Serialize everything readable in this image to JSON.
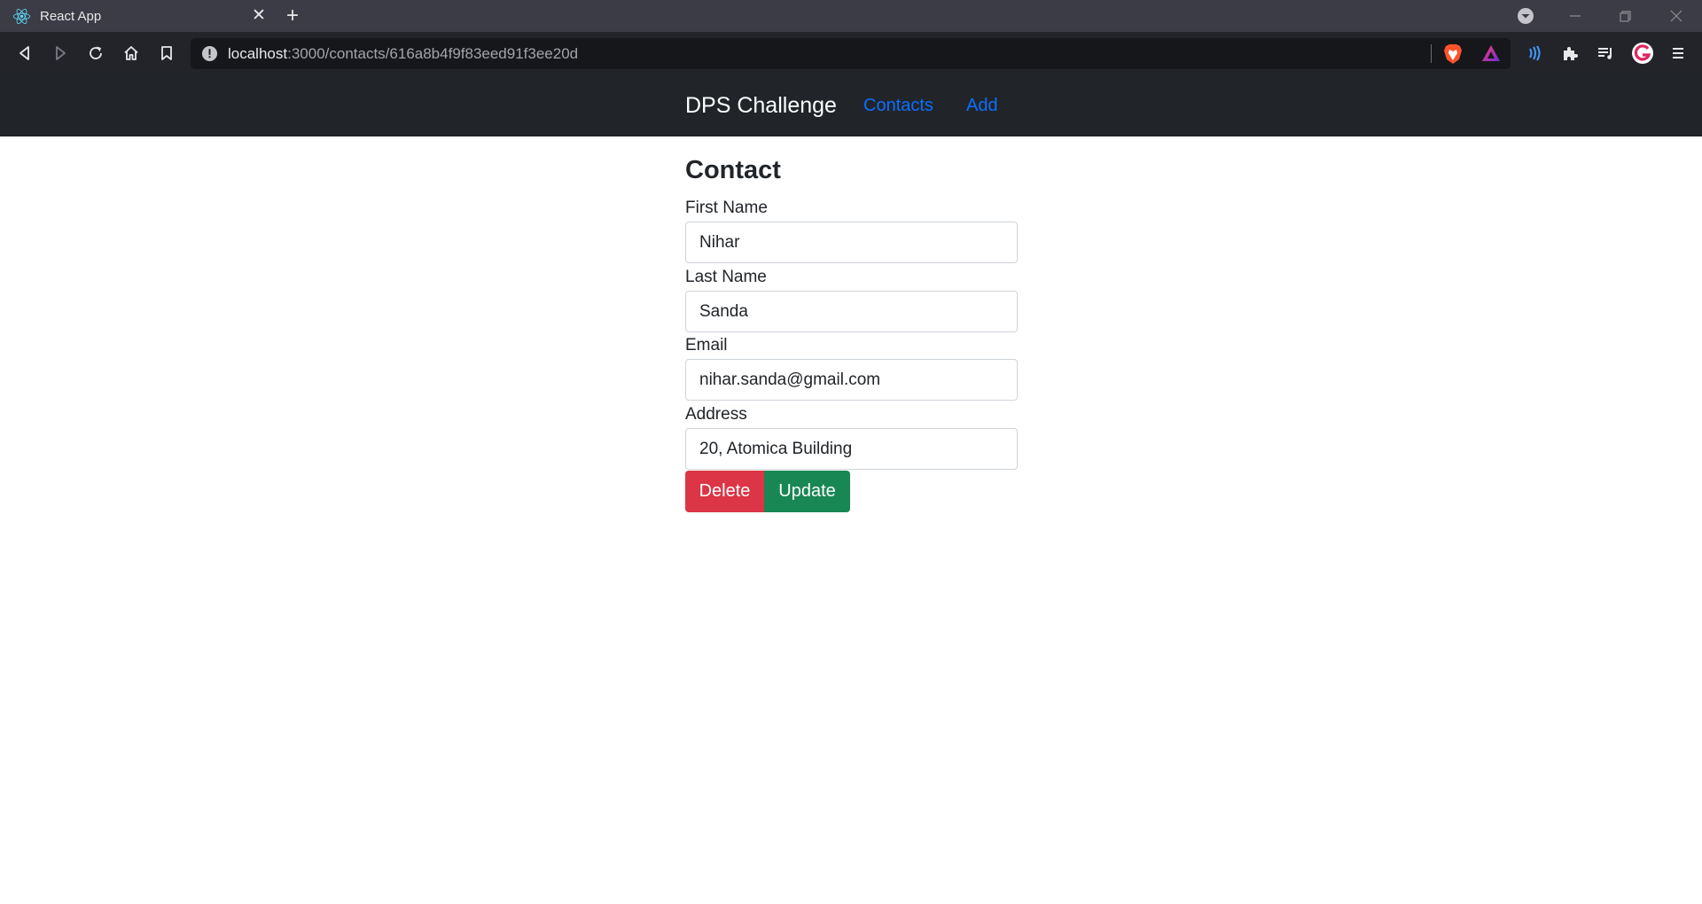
{
  "browser": {
    "tab_title": "React App",
    "new_tab_symbol": "+",
    "close_tab_symbol": "✕",
    "url_host": "localhost",
    "url_rest": ":3000/contacts/616a8b4f9f83eed91f3ee20d",
    "icons": [
      "react-favicon-icon",
      "back-icon",
      "forward-icon",
      "reload-icon",
      "home-icon",
      "bookmark-icon",
      "site-info-icon",
      "brave-shields-icon",
      "brave-rewards-icon",
      "wallet-icon",
      "extensions-icon",
      "playlist-icon",
      "profile-icon",
      "menu-icon",
      "tab-search-icon",
      "minimize-icon",
      "restore-icon",
      "close-window-icon"
    ]
  },
  "navbar": {
    "brand": "DPS Challenge",
    "links": [
      "Contacts",
      "Add"
    ]
  },
  "form": {
    "title": "Contact",
    "fields": [
      {
        "label": "First Name",
        "value": "Nihar"
      },
      {
        "label": "Last Name",
        "value": "Sanda"
      },
      {
        "label": "Email",
        "value": "nihar.sanda@gmail.com"
      },
      {
        "label": "Address",
        "value": "20, Atomica Building"
      }
    ],
    "delete_label": "Delete",
    "update_label": "Update"
  },
  "colors": {
    "navbar_bg": "#212529",
    "link": "#0d6efd",
    "delete": "#dc3545",
    "update": "#198754"
  }
}
